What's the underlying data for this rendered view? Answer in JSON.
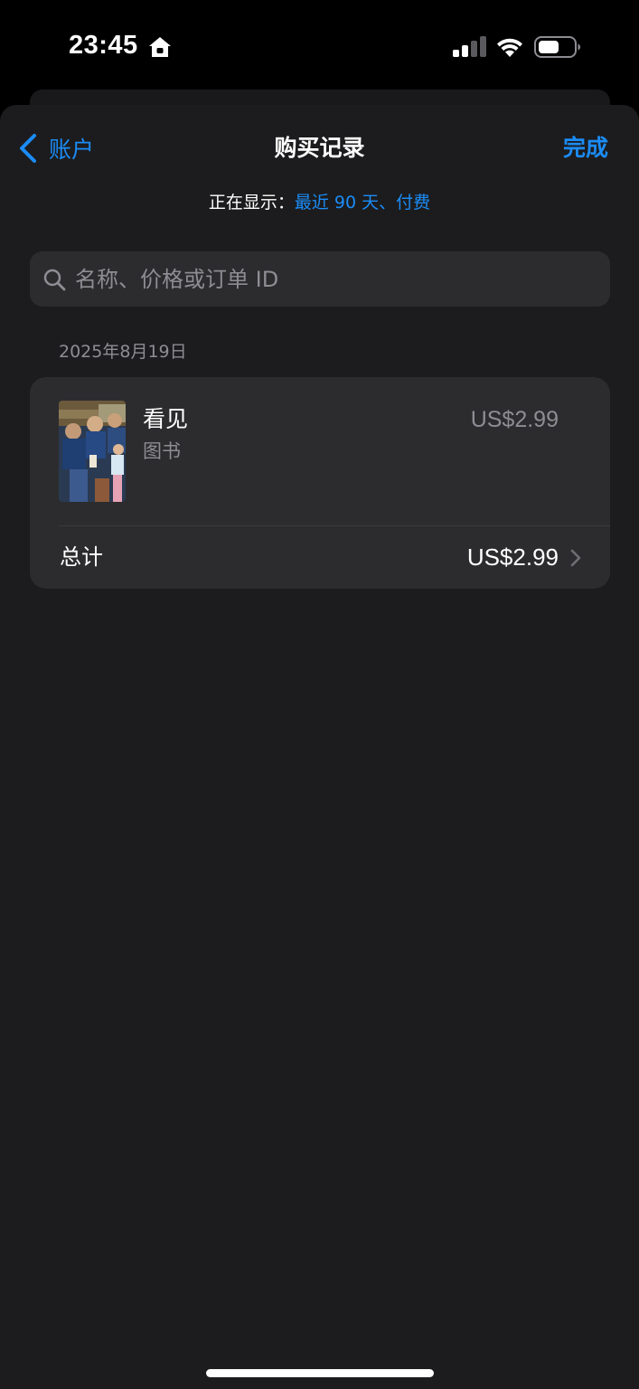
{
  "status_bar": {
    "time": "23:45",
    "icons": [
      "home-icon",
      "cellular-signal-icon",
      "wifi-icon",
      "battery-icon"
    ]
  },
  "nav": {
    "back_label": "账户",
    "title": "购买记录",
    "done_label": "完成"
  },
  "filter": {
    "label": "正在显示：",
    "value": "最近 90 天、付费"
  },
  "search": {
    "placeholder": "名称、价格或订单 ID"
  },
  "purchases": {
    "date": "2025年8月19日",
    "items": [
      {
        "title": "看见",
        "type": "图书",
        "price": "US$2.99",
        "cover_icon": "book-cover-photo"
      }
    ],
    "total_label": "总计",
    "total_value": "US$2.99"
  },
  "colors": {
    "accent": "#1b8cf6",
    "background": "#1c1c1e",
    "card": "#2c2c2e",
    "secondary_text": "#8d8d93"
  }
}
